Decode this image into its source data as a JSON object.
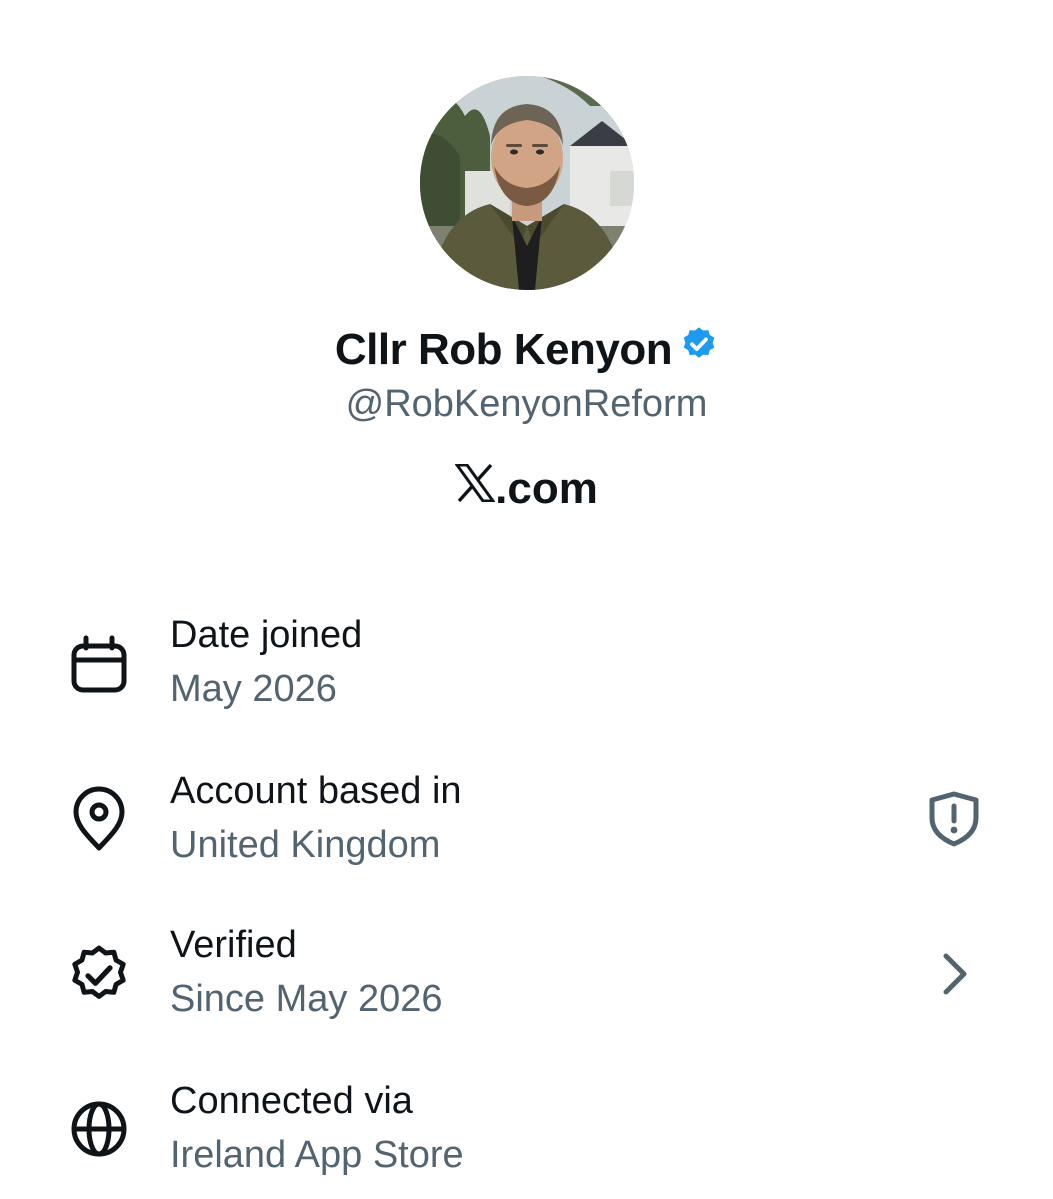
{
  "profile": {
    "display_name": "Cllr Rob Kenyon",
    "handle": "@RobKenyonReform",
    "site_suffix": ".com",
    "verified_badge_color": "#1d9bf0",
    "site_logo_icon": "x-logo-icon"
  },
  "about": {
    "items": [
      {
        "icon": "calendar-icon",
        "title": "Date joined",
        "value": "May 2026"
      },
      {
        "icon": "location-pin-icon",
        "title": "Account based in",
        "value": "United Kingdom",
        "trailing_icon": "shield-alert-icon"
      },
      {
        "icon": "verified-badge-outline-icon",
        "title": "Verified",
        "value": "Since May 2026",
        "trailing_icon": "chevron-right-icon"
      },
      {
        "icon": "globe-icon",
        "title": "Connected via",
        "value": "Ireland App Store"
      }
    ]
  },
  "colors": {
    "primary_text": "#0f1419",
    "secondary_text": "#536471",
    "background": "#ffffff",
    "verified_blue": "#1d9bf0"
  }
}
